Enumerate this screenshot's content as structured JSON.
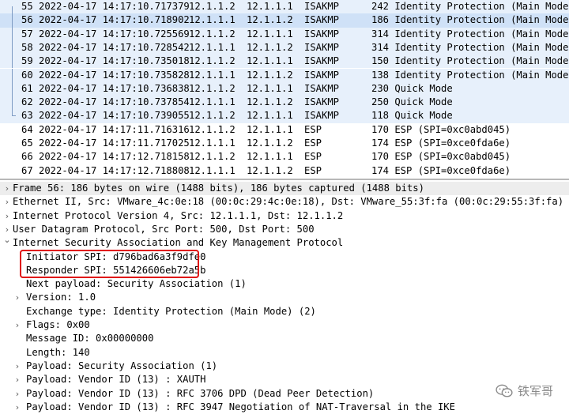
{
  "packets": [
    {
      "no": "55",
      "time": "2022-04-17 14:17:10.717379",
      "src": "12.1.1.2",
      "dst": "12.1.1.1",
      "proto": "ISAKMP",
      "len": "242",
      "info": "Identity Protection (Main Mode)"
    },
    {
      "no": "56",
      "time": "2022-04-17 14:17:10.718902",
      "src": "12.1.1.1",
      "dst": "12.1.1.2",
      "proto": "ISAKMP",
      "len": "186",
      "info": "Identity Protection (Main Mode)"
    },
    {
      "no": "57",
      "time": "2022-04-17 14:17:10.725569",
      "src": "12.1.1.2",
      "dst": "12.1.1.1",
      "proto": "ISAKMP",
      "len": "314",
      "info": "Identity Protection (Main Mode)"
    },
    {
      "no": "58",
      "time": "2022-04-17 14:17:10.728542",
      "src": "12.1.1.1",
      "dst": "12.1.1.2",
      "proto": "ISAKMP",
      "len": "314",
      "info": "Identity Protection (Main Mode)"
    },
    {
      "no": "59",
      "time": "2022-04-17 14:17:10.735018",
      "src": "12.1.1.2",
      "dst": "12.1.1.1",
      "proto": "ISAKMP",
      "len": "150",
      "info": "Identity Protection (Main Mode)"
    },
    {
      "no": "60",
      "time": "2022-04-17 14:17:10.735828",
      "src": "12.1.1.1",
      "dst": "12.1.1.2",
      "proto": "ISAKMP",
      "len": "138",
      "info": "Identity Protection (Main Mode)"
    },
    {
      "no": "61",
      "time": "2022-04-17 14:17:10.736838",
      "src": "12.1.1.2",
      "dst": "12.1.1.1",
      "proto": "ISAKMP",
      "len": "230",
      "info": "Quick Mode"
    },
    {
      "no": "62",
      "time": "2022-04-17 14:17:10.737854",
      "src": "12.1.1.1",
      "dst": "12.1.1.2",
      "proto": "ISAKMP",
      "len": "250",
      "info": "Quick Mode"
    },
    {
      "no": "63",
      "time": "2022-04-17 14:17:10.739055",
      "src": "12.1.1.2",
      "dst": "12.1.1.1",
      "proto": "ISAKMP",
      "len": "118",
      "info": "Quick Mode"
    },
    {
      "no": "64",
      "time": "2022-04-17 14:17:11.716316",
      "src": "12.1.1.2",
      "dst": "12.1.1.1",
      "proto": "ESP",
      "len": "170",
      "info": "ESP (SPI=0xc0abd045)"
    },
    {
      "no": "65",
      "time": "2022-04-17 14:17:11.717025",
      "src": "12.1.1.1",
      "dst": "12.1.1.2",
      "proto": "ESP",
      "len": "174",
      "info": "ESP (SPI=0xce0fda6e)"
    },
    {
      "no": "66",
      "time": "2022-04-17 14:17:12.718158",
      "src": "12.1.1.2",
      "dst": "12.1.1.1",
      "proto": "ESP",
      "len": "170",
      "info": "ESP (SPI=0xc0abd045)"
    },
    {
      "no": "67",
      "time": "2022-04-17 14:17:12.718808",
      "src": "12.1.1.1",
      "dst": "12.1.1.2",
      "proto": "ESP",
      "len": "174",
      "info": "ESP (SPI=0xce0fda6e)"
    }
  ],
  "selected_packet": "56",
  "details": [
    {
      "text": "Frame 56: 186 bytes on wire (1488 bits), 186 bytes captured (1488 bits)",
      "expander": "collapsed",
      "level": 0
    },
    {
      "text": "Ethernet II, Src: VMware_4c:0e:18 (00:0c:29:4c:0e:18), Dst: VMware_55:3f:fa (00:0c:29:55:3f:fa)",
      "expander": "collapsed",
      "level": 0
    },
    {
      "text": "Internet Protocol Version 4, Src: 12.1.1.1, Dst: 12.1.1.2",
      "expander": "collapsed",
      "level": 0
    },
    {
      "text": "User Datagram Protocol, Src Port: 500, Dst Port: 500",
      "expander": "collapsed",
      "level": 0
    },
    {
      "text": "Internet Security Association and Key Management Protocol",
      "expander": "expanded",
      "level": 0
    },
    {
      "text": "Initiator SPI: d796bad6a3f9dfe0",
      "expander": "none",
      "level": 1
    },
    {
      "text": "Responder SPI: 551426606eb72a5b",
      "expander": "none",
      "level": 1
    },
    {
      "text": "Next payload: Security Association (1)",
      "expander": "none",
      "level": 1
    },
    {
      "text": "Version: 1.0",
      "expander": "collapsed",
      "level": 1
    },
    {
      "text": "Exchange type: Identity Protection (Main Mode) (2)",
      "expander": "none",
      "level": 1
    },
    {
      "text": "Flags: 0x00",
      "expander": "collapsed",
      "level": 1
    },
    {
      "text": "Message ID: 0x00000000",
      "expander": "none",
      "level": 1
    },
    {
      "text": "Length: 140",
      "expander": "none",
      "level": 1
    },
    {
      "text": "Payload: Security Association (1)",
      "expander": "collapsed",
      "level": 1
    },
    {
      "text": "Payload: Vendor ID (13) : XAUTH",
      "expander": "collapsed",
      "level": 1
    },
    {
      "text": "Payload: Vendor ID (13) : RFC 3706 DPD (Dead Peer Detection)",
      "expander": "collapsed",
      "level": 1
    },
    {
      "text": "Payload: Vendor ID (13) : RFC 3947 Negotiation of NAT-Traversal in the IKE",
      "expander": "collapsed",
      "level": 1
    }
  ],
  "watermark": {
    "text": "铁军哥",
    "icon": "wechat-icon"
  },
  "colors": {
    "isakmp_row": "#e7f0fb",
    "selected_row": "#cfe1f7",
    "highlight_box": "#e01010"
  }
}
